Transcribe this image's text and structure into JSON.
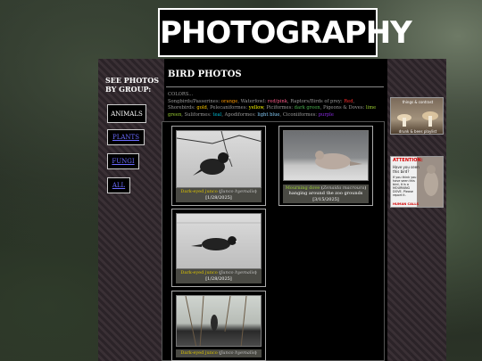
{
  "header": {
    "banner_text": "PHOTOGRAPHY"
  },
  "sidebar": {
    "title": "SEE PHOTOS BY GROUP:",
    "buttons": [
      "ANIMALS",
      "PLANTS",
      "FUNGI",
      "ALL"
    ]
  },
  "main": {
    "title": "BIRD PHOTOS",
    "colors_intro": "COLORS...",
    "legend": [
      {
        "group": "Songbirds/Passerines:",
        "color_word": "orange",
        "color": "#ff9900"
      },
      {
        "group": "Waterfowl:",
        "color_word": "red/pink",
        "color": "#ff5c8a"
      },
      {
        "group": "Raptors/Birds of prey:",
        "color_word": "Red",
        "color": "#ff2b2b"
      },
      {
        "group": "Shorebirds:",
        "color_word": "gold",
        "color": "#ffcc00"
      },
      {
        "group": "Pelecaniformes:",
        "color_word": "yellow",
        "color": "#ffff00"
      },
      {
        "group": "Piciformes:",
        "color_word": "dark green",
        "color": "#4caf50"
      },
      {
        "group": "Pigeons & Doves:",
        "color_word": "lime green",
        "color": "#9acd32"
      },
      {
        "group": "Suliformes:",
        "color_word": "teal",
        "color": "#00bcd4"
      },
      {
        "group": "Apodiformes:",
        "color_word": "light blue",
        "color": "#87cefa"
      },
      {
        "group": "Ciconiiformes:",
        "color_word": "purple",
        "color": "#8a2be2"
      }
    ]
  },
  "gallery": [
    {
      "name": "Dark-eyed junco",
      "sci": "Junco hyemalis",
      "date": "[1/28/2025]",
      "extra": ""
    },
    {
      "name": "Mourning dove",
      "sci": "Zenaida macroura",
      "date": "[3/15/2025]",
      "extra": "hanging around the zoo grounds"
    },
    {
      "name": "Dark-eyed junco",
      "sci": "Junco hyemalis",
      "date": "[1/28/2025]",
      "extra": ""
    },
    {
      "name": "Dark-eyed junco",
      "sci": "Junco hyemalis",
      "date": "",
      "extra": ""
    }
  ],
  "ads": {
    "ad1_title": "things & contrast",
    "ad1_sub": "drunk & bees playlist",
    "ad2_attention": "ATTENTION:",
    "ad2_line1": "Have you seen",
    "ad2_line2": "this bird?",
    "ad2_body": "If you think you have seen this bird, it is a MOURNING DOVE. Please report it.",
    "ad2_footer": "HUMAN CALLS"
  }
}
